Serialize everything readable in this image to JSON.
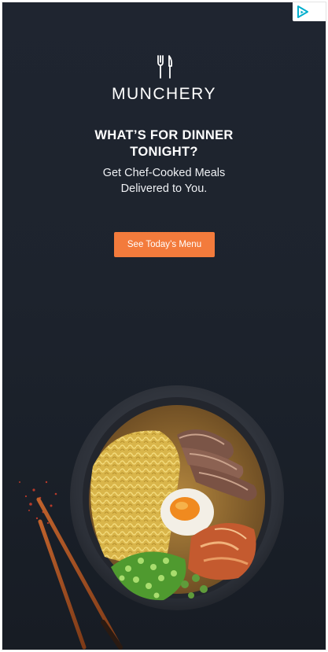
{
  "ad": {
    "adchoices_icon": "adchoices-icon",
    "brand": {
      "logo_icon": "fork-knife-icon",
      "name": "MUNCHERY"
    },
    "headline": [
      "WHAT’S FOR DINNER",
      "TONIGHT?"
    ],
    "subhead": [
      "Get Chef-Cooked Meals",
      "Delivered to You."
    ],
    "cta_label": "See Today’s Menu",
    "image": "ramen-bowl-with-chopsticks",
    "colors": {
      "background": "#1f2530",
      "cta": "#f37b3c",
      "adchoices": "#00aecd"
    }
  }
}
